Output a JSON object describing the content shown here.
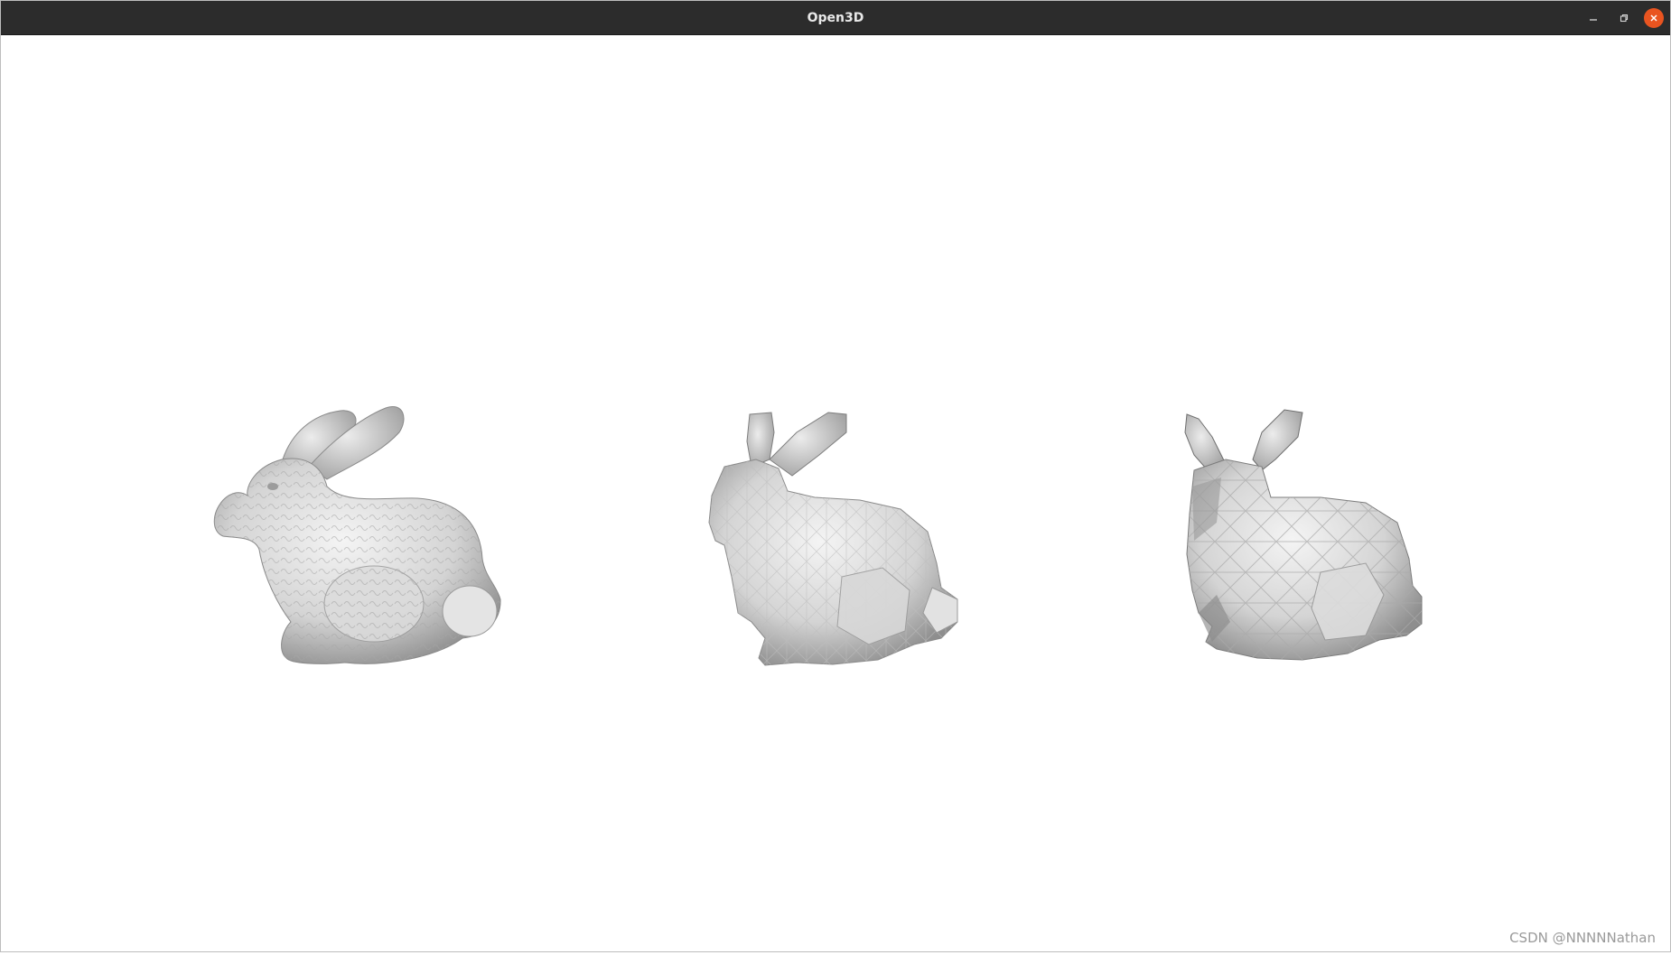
{
  "window": {
    "title": "Open3D",
    "controls": {
      "minimize_icon": "minimize-icon",
      "maximize_icon": "restore-icon",
      "close_icon": "close-icon",
      "close_color": "#e95420"
    }
  },
  "viewport": {
    "background": "#ffffff",
    "meshes": [
      {
        "name": "original-mesh",
        "style": "smooth, high detail"
      },
      {
        "name": "simplified-mesh-medium",
        "style": "faceted, medium detail"
      },
      {
        "name": "simplified-mesh-coarse",
        "style": "faceted, low detail"
      }
    ]
  },
  "watermark": "CSDN @NNNNNathan"
}
